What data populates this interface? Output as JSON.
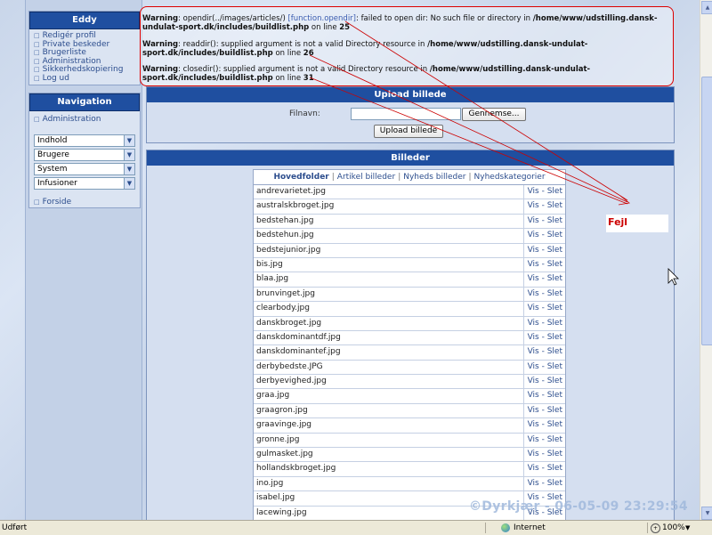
{
  "warnings": [
    {
      "label": "Warning",
      "pre": ": opendir(../images/articles/) ",
      "fn": "[function.opendir]",
      "msg": ": failed to open dir: No such file or directory in ",
      "path": "/home/www/udstilling.dansk-undulat-sport.dk/includes/buildlist.php",
      "online": " on line ",
      "line": "25"
    },
    {
      "label": "Warning",
      "pre": ": readdir(): supplied argument is not a valid Directory resource in ",
      "fn": "",
      "msg": "",
      "path": "/home/www/udstilling.dansk-undulat-sport.dk/includes/buildlist.php",
      "online": " on line ",
      "line": "26"
    },
    {
      "label": "Warning",
      "pre": ": closedir(): supplied argument is not a valid Directory resource in ",
      "fn": "",
      "msg": "",
      "path": "/home/www/udstilling.dansk-undulat-sport.dk/includes/buildlist.php",
      "online": " on line ",
      "line": "31"
    }
  ],
  "user_box": {
    "title": "Eddy",
    "items": [
      "Redigér profil",
      "Private beskeder",
      "Brugerliste",
      "Administration",
      "Sikkerhedskopiering",
      "Log ud"
    ]
  },
  "nav_box": {
    "title": "Navigation",
    "admin_link": "Administration",
    "selects": [
      "Indhold",
      "Brugere",
      "System",
      "Infusioner"
    ],
    "home_link": "Forside"
  },
  "upload": {
    "title": "Upload billede",
    "filename_label": "Filnavn:",
    "browse_label": "Gennemse...",
    "upload_label": "Upload billede"
  },
  "images": {
    "title": "Billeder",
    "tabs": [
      "Hovedfolder",
      "Artikel billeder",
      "Nyheds billeder",
      "Nyhedskategorier"
    ],
    "view_label": "Vis",
    "delete_label": "Slet",
    "files": [
      "andrevarietet.jpg",
      "australskbroget.jpg",
      "bedstehan.jpg",
      "bedstehun.jpg",
      "bedstejunior.jpg",
      "bis.jpg",
      "blaa.jpg",
      "brunvinget.jpg",
      "clearbody.jpg",
      "danskbroget.jpg",
      "danskdominantdf.jpg",
      "danskdominantef.jpg",
      "derbybedste.JPG",
      "derbyevighed.jpg",
      "graa.jpg",
      "graagron.jpg",
      "graavinge.jpg",
      "gronne.jpg",
      "gulmasket.jpg",
      "hollandskbroget.jpg",
      "ino.jpg",
      "isabel.jpg",
      "lacewing.jpg"
    ]
  },
  "annotation": {
    "label": "Fejl",
    "color": "#cc0000"
  },
  "watermark": "©Dyrkjær - 06-05-09 23:29:54",
  "statusbar": {
    "status": "Udført",
    "zone": "Internet",
    "zoom": "100%"
  },
  "colors": {
    "header_blue": "#1f4fa0",
    "link_blue": "#2c4d8d",
    "warning_border": "#dd0000"
  }
}
